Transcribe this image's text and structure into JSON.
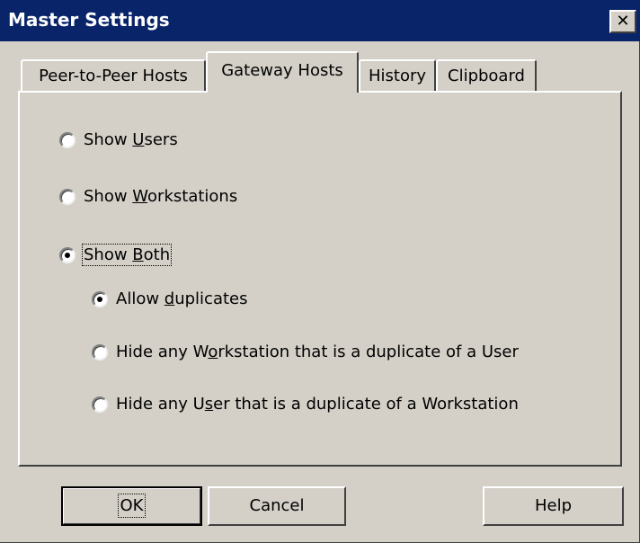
{
  "window": {
    "title": "Master Settings",
    "close_glyph": "✕"
  },
  "tabs": [
    {
      "label": "Peer-to-Peer Hosts",
      "active": false
    },
    {
      "label": "Gateway Hosts",
      "active": true
    },
    {
      "label": "History",
      "active": false
    },
    {
      "label": "Clipboard",
      "active": false
    }
  ],
  "options": {
    "show_users": {
      "pre": "Show ",
      "key": "U",
      "post": "sers",
      "checked": false
    },
    "show_workstations": {
      "pre": "Show ",
      "key": "W",
      "post": "orkstations",
      "checked": false
    },
    "show_both": {
      "pre": "Show ",
      "key": "B",
      "post": "oth",
      "checked": true
    },
    "allow_duplicates": {
      "pre": "Allow ",
      "key": "d",
      "post": "uplicates",
      "checked": true
    },
    "hide_workstation": {
      "pre": "Hide any W",
      "key": "o",
      "post": "rkstation that is a duplicate of a User",
      "checked": false
    },
    "hide_user": {
      "pre": "Hide any U",
      "key": "s",
      "post": "er that is a duplicate of a Workstation",
      "checked": false
    }
  },
  "buttons": {
    "ok": "OK",
    "cancel": "Cancel",
    "help": "Help"
  },
  "colors": {
    "face": "#d4d0c8",
    "title_bar": "#0a246a"
  }
}
